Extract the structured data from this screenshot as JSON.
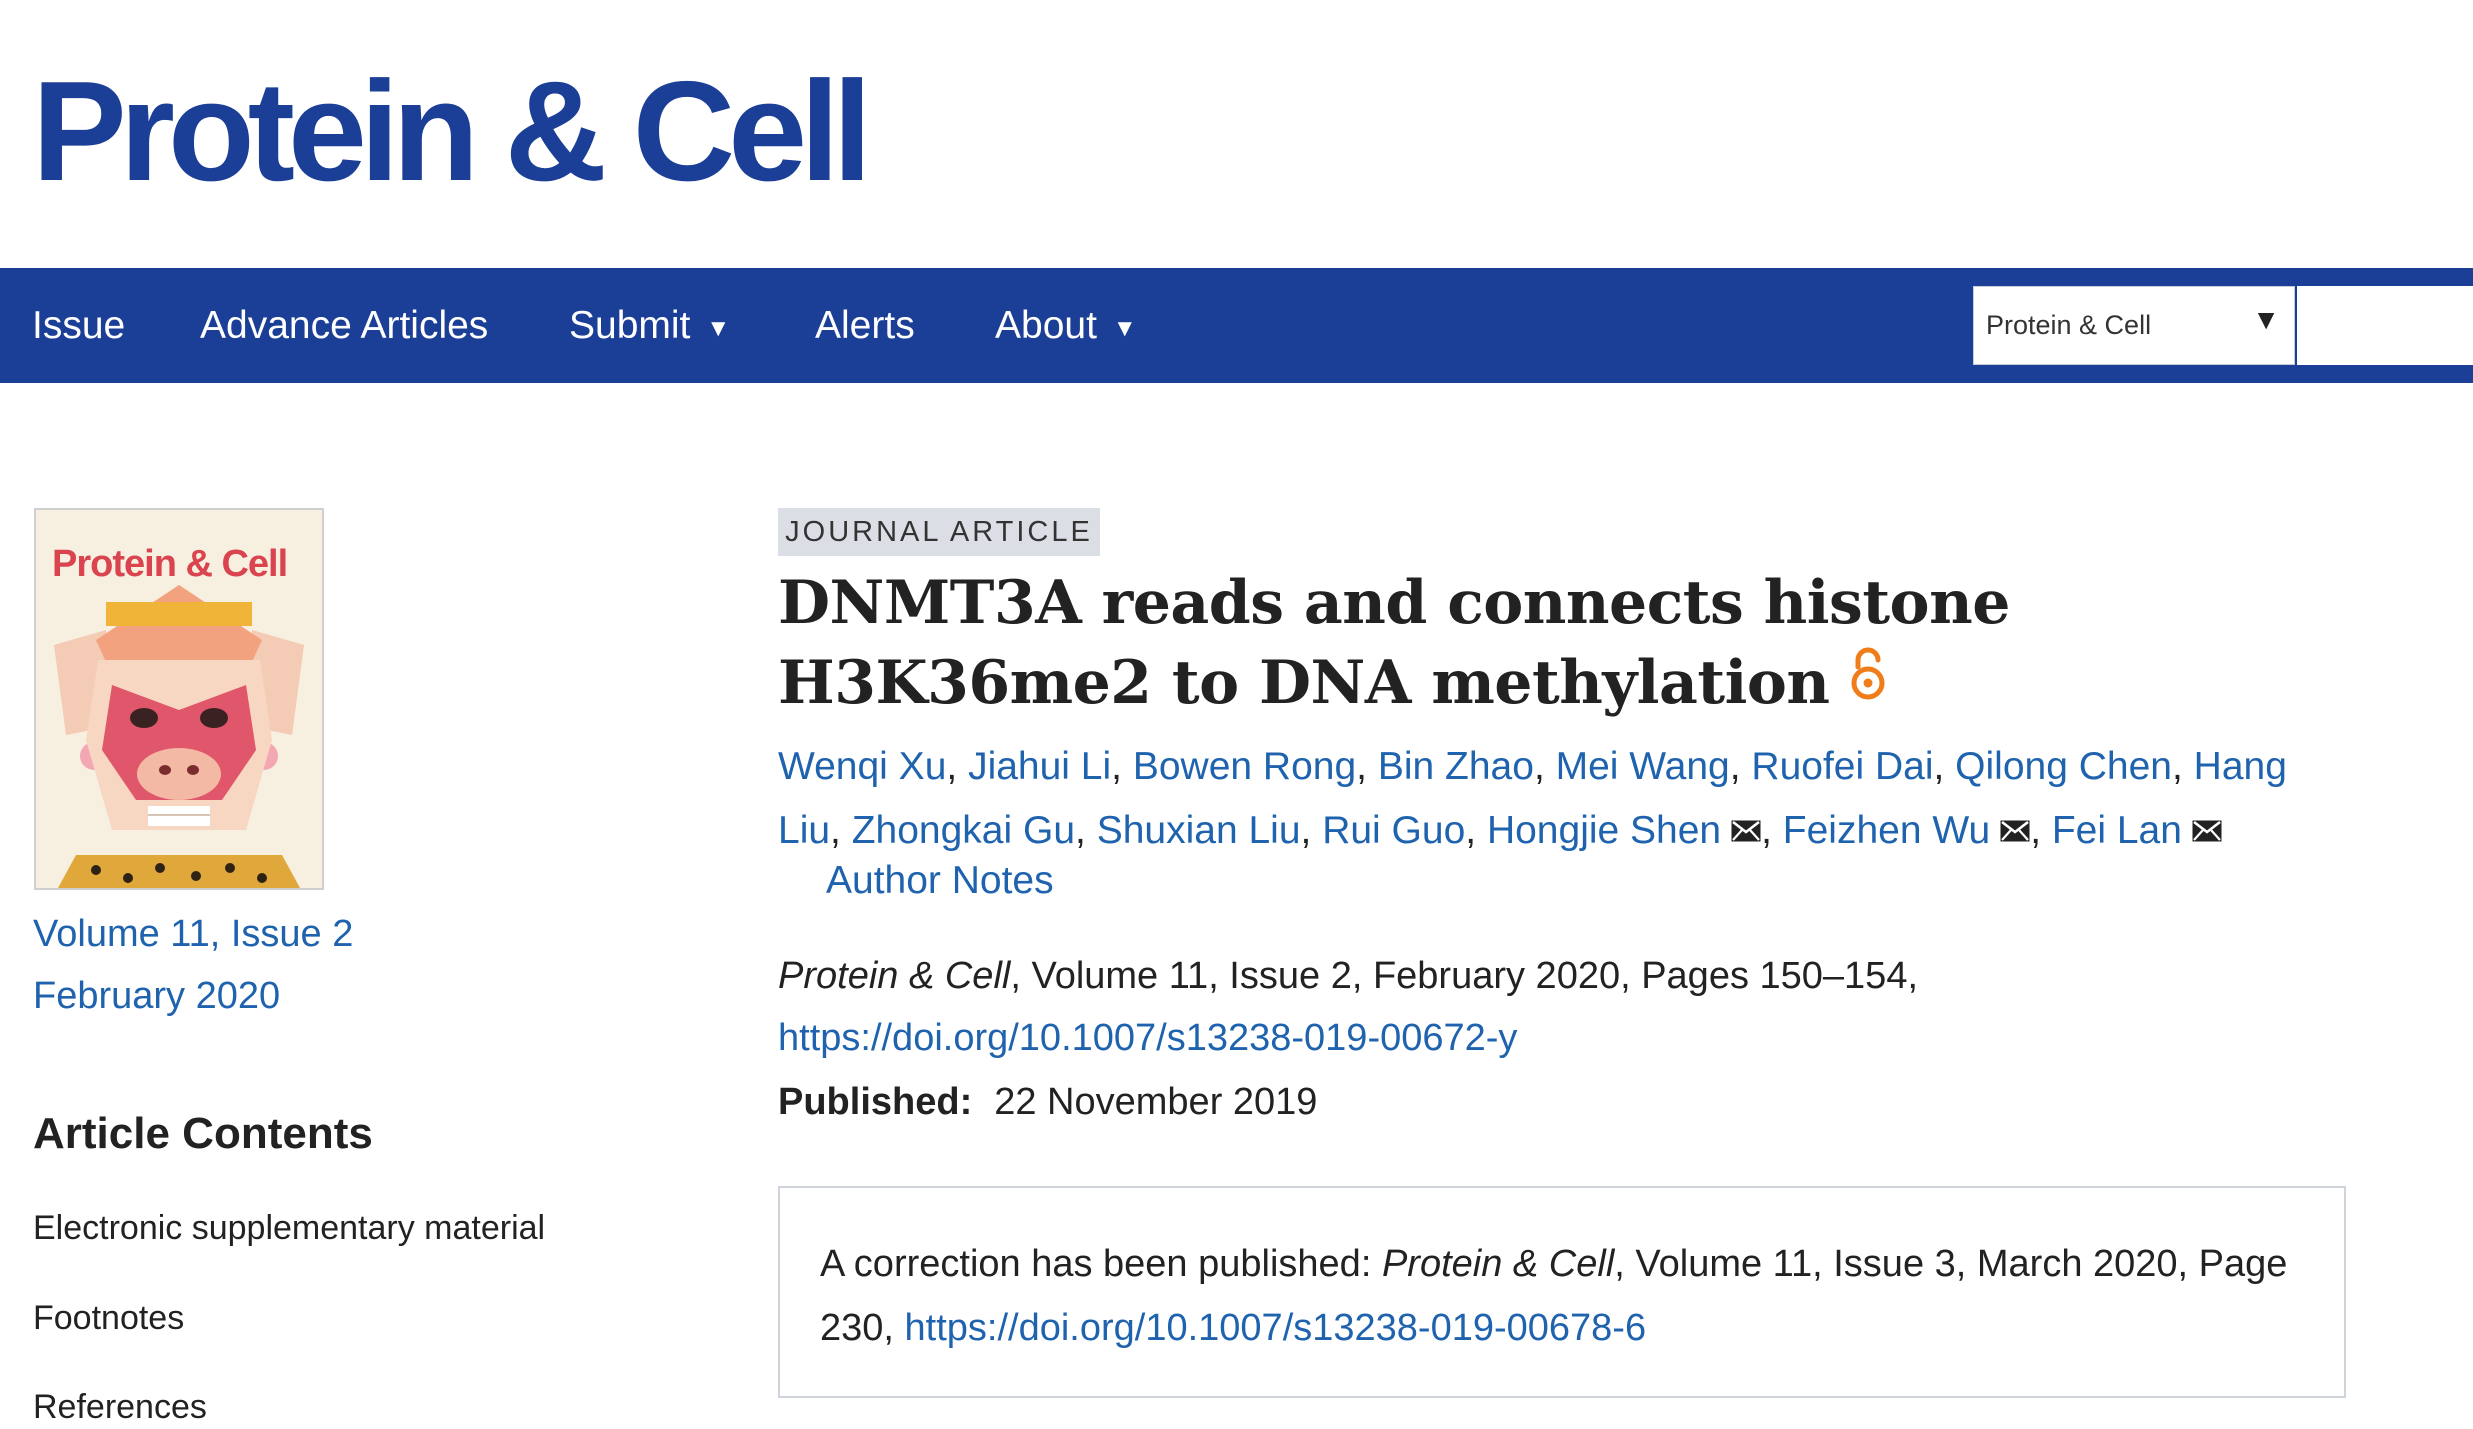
{
  "header": {
    "logo_text": "Protein & Cell"
  },
  "nav": {
    "items": [
      {
        "label": "Issue",
        "has_menu": false
      },
      {
        "label": "Advance Articles",
        "has_menu": false
      },
      {
        "label": "Submit",
        "has_menu": true
      },
      {
        "label": "Alerts",
        "has_menu": false
      },
      {
        "label": "About",
        "has_menu": true
      }
    ],
    "search_scope": "Protein & Cell",
    "search_value": ""
  },
  "sidebar": {
    "cover_title": "Protein & Cell",
    "volume_issue": "Volume 11, Issue 2",
    "issue_date": "February 2020",
    "contents_title": "Article Contents",
    "contents": [
      "Electronic supplementary material",
      "Footnotes",
      "References"
    ]
  },
  "article": {
    "type_badge": "JOURNAL ARTICLE",
    "title": "DNMT3A reads and connects histone H3K36me2 to DNA methylation",
    "authors": [
      {
        "name": "Wenqi Xu",
        "corresponding": false
      },
      {
        "name": "Jiahui Li",
        "corresponding": false
      },
      {
        "name": "Bowen Rong",
        "corresponding": false
      },
      {
        "name": "Bin Zhao",
        "corresponding": false
      },
      {
        "name": "Mei Wang",
        "corresponding": false
      },
      {
        "name": "Ruofei Dai",
        "corresponding": false
      },
      {
        "name": "Qilong Chen",
        "corresponding": false
      },
      {
        "name": "Hang Liu",
        "corresponding": false
      },
      {
        "name": "Zhongkai Gu",
        "corresponding": false
      },
      {
        "name": "Shuxian Liu",
        "corresponding": false
      },
      {
        "name": "Rui Guo",
        "corresponding": false
      },
      {
        "name": "Hongjie Shen",
        "corresponding": true
      },
      {
        "name": "Feizhen Wu",
        "corresponding": true
      },
      {
        "name": "Fei Lan",
        "corresponding": true
      }
    ],
    "author_notes_label": "Author Notes",
    "citation": {
      "journal": "Protein & Cell",
      "rest": ", Volume 11, Issue 2, February 2020, Pages 150–154,"
    },
    "doi": "https://doi.org/10.1007/s13238-019-00672-y",
    "published_label": "Published:",
    "published_date": "22 November 2019",
    "correction": {
      "prefix": "A correction has been published: ",
      "journal": "Protein & Cell",
      "rest": ", Volume 11, Issue 3, March 2020, Page 230, ",
      "doi": "https://doi.org/10.1007/s13238-019-00678-6"
    }
  },
  "colors": {
    "brand_blue": "#1b3e96",
    "link_blue": "#1f63ae",
    "open_access_orange": "#f07d1a",
    "badge_bg": "#dcdee5"
  },
  "icons": [
    "open-access-icon",
    "mail-icon",
    "caret-down-icon"
  ]
}
